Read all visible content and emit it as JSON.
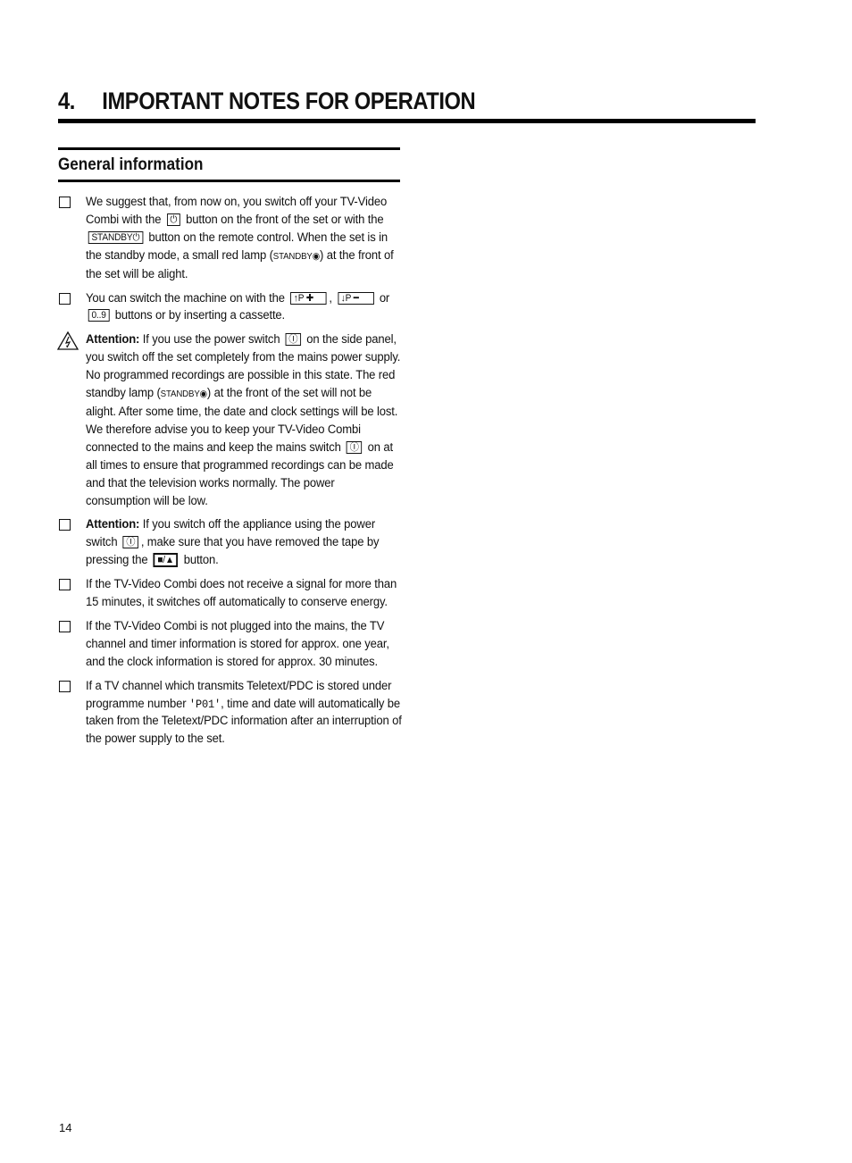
{
  "chapter": {
    "number": "4.",
    "title": "IMPORTANT NOTES FOR OPERATION"
  },
  "section": {
    "title": "General information"
  },
  "items": [
    {
      "type": "bullet",
      "parts": {
        "a": "We suggest that, from now on, you switch off your TV-Video Combi with the",
        "key1": "⏻",
        "b": "button on the front of the set or with the",
        "key2": "STANDBY⏻",
        "c": "button on the remote control. When the set is in the standby mode, a small red lamp (",
        "lamp": "STANDBY◉",
        "d": ") at the front of the set will be alight."
      }
    },
    {
      "type": "bullet",
      "parts": {
        "a": "You can switch the machine on with the",
        "key1": "↑P ✚",
        "b": ",",
        "key2": "↓P ━",
        "c": "or",
        "key3": "0..9",
        "d": "buttons or by inserting a cassette."
      }
    },
    {
      "type": "warning",
      "parts": {
        "label": "Attention:",
        "a": "If you use the power switch",
        "key1": "Ⓘ",
        "b": "on the side panel, you switch off the set completely from the mains power supply. No programmed recordings are possible in this state. The red standby lamp (",
        "lamp": "STANDBY◉",
        "c": ") at the front of the set will not be alight. After some time, the date and clock settings will be lost.",
        "d": "We therefore advise you to keep your TV-Video Combi connected to the mains and keep the mains switch",
        "key2": "Ⓘ",
        "e": "on at all times to ensure that programmed recordings can be made and that the television works normally. The power consumption will be low."
      }
    },
    {
      "type": "bullet",
      "parts": {
        "label": "Attention:",
        "a": "If you switch off the appliance using the power switch",
        "key1": "Ⓘ",
        "b": ", make sure that you have removed the tape by pressing the",
        "key2": "■/▲",
        "c": "button."
      }
    },
    {
      "type": "bullet",
      "parts": {
        "a": "If the TV-Video Combi does not receive a signal for more than 15 minutes, it switches off automatically to conserve energy."
      }
    },
    {
      "type": "bullet",
      "parts": {
        "a": "If the TV-Video Combi is not plugged into the mains, the TV channel and timer information is stored for approx. one year, and the clock information is stored for approx. 30 minutes."
      }
    },
    {
      "type": "bullet",
      "parts": {
        "a": "If a TV channel which transmits Teletext/PDC is stored under programme number",
        "code": "'P01'",
        "b": ", time and date will automatically be taken from the Teletext/PDC information after an interruption of the power supply to the set."
      }
    }
  ],
  "icons": {
    "bullet": "checkbox-square-icon",
    "warning": "lightning-warning-triangle-icon"
  },
  "page_number": "14"
}
